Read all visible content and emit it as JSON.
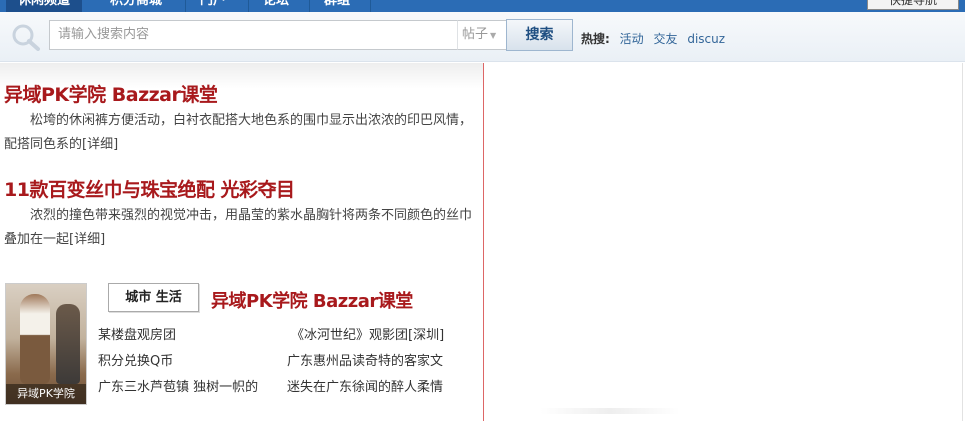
{
  "nav": {
    "tabs": [
      "休闲频道",
      "积分商城",
      "门户",
      "论坛",
      "群组"
    ],
    "quick_label": "快捷导航"
  },
  "search": {
    "placeholder": "请输入搜索内容",
    "type_label": "帖子",
    "button_label": "搜索",
    "hot_label": "热搜:",
    "hot_terms": [
      "活动",
      "交友",
      "discuz"
    ]
  },
  "articles": [
    {
      "title": "异域PK学院 Bazzar课堂",
      "desc": "松垮的休闲裤方便活动，白衬衣配搭大地色系的围巾显示出浓浓的印巴风情，配搭同色系的",
      "more": "[详细]"
    },
    {
      "title": "11款百变丝巾与珠宝绝配 光彩夺目",
      "desc": "浓烈的撞色带来强烈的视觉冲击，用晶莹的紫水晶胸针将两条不同颜色的丝巾叠加在一起",
      "more": "[详细]"
    }
  ],
  "city": {
    "tag": "城市 生活",
    "title": "异域PK学院 Bazzar课堂",
    "thumb_caption": "异域PK学院",
    "links": [
      "某楼盘观房团",
      "《冰河世纪》观影团[深圳]",
      "积分兑换Q币",
      "广东惠州品读奇特的客家文",
      "广东三水芦苞镇 独树一帜的",
      "迷失在广东徐闻的醉人柔情"
    ]
  },
  "colors": {
    "nav_bg": "#2b6cb5",
    "title_red": "#a8191c",
    "link_blue": "#336699"
  }
}
